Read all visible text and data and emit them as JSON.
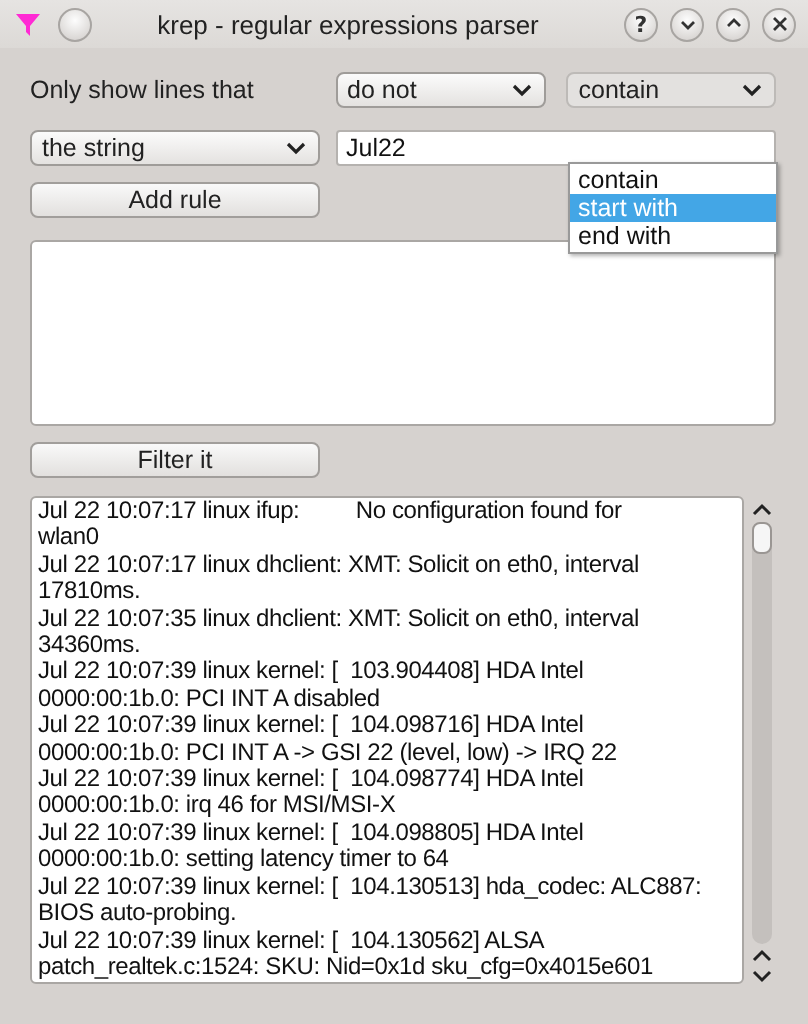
{
  "window": {
    "title": "krep - regular expressions parser",
    "buttons": [
      {
        "kind": "help",
        "label": "?"
      },
      {
        "kind": "minimize"
      },
      {
        "kind": "maximize"
      },
      {
        "kind": "close"
      }
    ]
  },
  "rule": {
    "label": "Only show lines that",
    "negation": {
      "value": "do not"
    },
    "match": {
      "value": "contain",
      "expanded": true,
      "options": [
        {
          "label": "contain",
          "highlighted": false
        },
        {
          "label": "start with",
          "highlighted": true
        },
        {
          "label": "end with",
          "highlighted": false
        }
      ]
    },
    "target": {
      "value": "the string"
    },
    "pattern": {
      "value": "Jul22"
    }
  },
  "add_button": "Add rule",
  "filter_button": "Filter it",
  "log": {
    "lines": [
      "Jul 22 10:07:17 linux ifup:         No configuration found for",
      "wlan0",
      "Jul 22 10:07:17 linux dhclient: XMT: Solicit on eth0, interval",
      "17810ms.",
      "Jul 22 10:07:35 linux dhclient: XMT: Solicit on eth0, interval",
      "34360ms.",
      "Jul 22 10:07:39 linux kernel: [  103.904408] HDA Intel",
      "0000:00:1b.0: PCI INT A disabled",
      "Jul 22 10:07:39 linux kernel: [  104.098716] HDA Intel",
      "0000:00:1b.0: PCI INT A -> GSI 22 (level, low) -> IRQ 22",
      "Jul 22 10:07:39 linux kernel: [  104.098774] HDA Intel",
      "0000:00:1b.0: irq 46 for MSI/MSI-X",
      "Jul 22 10:07:39 linux kernel: [  104.098805] HDA Intel",
      "0000:00:1b.0: setting latency timer to 64",
      "Jul 22 10:07:39 linux kernel: [  104.130513] hda_codec: ALC887:",
      "BIOS auto-probing.",
      "Jul 22 10:07:39 linux kernel: [  104.130562] ALSA",
      "patch_realtek.c:1524: SKU: Nid=0x1d sku_cfg=0x4015e601"
    ]
  }
}
